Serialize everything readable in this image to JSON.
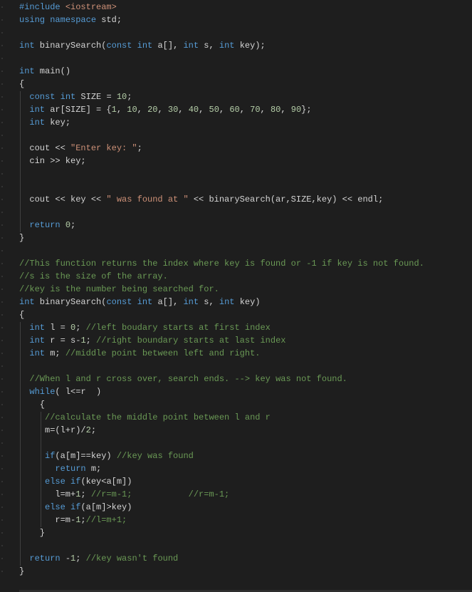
{
  "colors": {
    "background": "#1e1e1e",
    "keyword": "#569cd6",
    "string": "#ce9178",
    "number": "#b5cea8",
    "comment": "#6a9955",
    "text": "#d4d4d4"
  },
  "lines": [
    [
      [
        "p",
        "#include "
      ],
      [
        "s",
        "<iostream>"
      ]
    ],
    [
      [
        "k",
        "using"
      ],
      [
        "t",
        " "
      ],
      [
        "k",
        "namespace"
      ],
      [
        "t",
        " std;"
      ]
    ],
    [],
    [
      [
        "k",
        "int"
      ],
      [
        "t",
        " binarySearch("
      ],
      [
        "k",
        "const"
      ],
      [
        "t",
        " "
      ],
      [
        "k",
        "int"
      ],
      [
        "t",
        " a[], "
      ],
      [
        "k",
        "int"
      ],
      [
        "t",
        " s, "
      ],
      [
        "k",
        "int"
      ],
      [
        "t",
        " key);"
      ]
    ],
    [],
    [
      [
        "k",
        "int"
      ],
      [
        "t",
        " main()"
      ]
    ],
    [
      [
        "t",
        "{"
      ]
    ],
    [
      [
        "t",
        "  "
      ],
      [
        "k",
        "const"
      ],
      [
        "t",
        " "
      ],
      [
        "k",
        "int"
      ],
      [
        "t",
        " SIZE = "
      ],
      [
        "n",
        "10"
      ],
      [
        "t",
        ";"
      ]
    ],
    [
      [
        "t",
        "  "
      ],
      [
        "k",
        "int"
      ],
      [
        "t",
        " ar[SIZE] = {"
      ],
      [
        "n",
        "1"
      ],
      [
        "t",
        ", "
      ],
      [
        "n",
        "10"
      ],
      [
        "t",
        ", "
      ],
      [
        "n",
        "20"
      ],
      [
        "t",
        ", "
      ],
      [
        "n",
        "30"
      ],
      [
        "t",
        ", "
      ],
      [
        "n",
        "40"
      ],
      [
        "t",
        ", "
      ],
      [
        "n",
        "50"
      ],
      [
        "t",
        ", "
      ],
      [
        "n",
        "60"
      ],
      [
        "t",
        ", "
      ],
      [
        "n",
        "70"
      ],
      [
        "t",
        ", "
      ],
      [
        "n",
        "80"
      ],
      [
        "t",
        ", "
      ],
      [
        "n",
        "90"
      ],
      [
        "t",
        "};"
      ]
    ],
    [
      [
        "t",
        "  "
      ],
      [
        "k",
        "int"
      ],
      [
        "t",
        " key;"
      ]
    ],
    [],
    [
      [
        "t",
        "  cout << "
      ],
      [
        "s",
        "\"Enter key: \""
      ],
      [
        "t",
        ";"
      ]
    ],
    [
      [
        "t",
        "  cin >> key;"
      ]
    ],
    [],
    [],
    [
      [
        "t",
        "  cout << key << "
      ],
      [
        "s",
        "\" was found at \""
      ],
      [
        "t",
        " << binarySearch(ar,SIZE,key) << endl;"
      ]
    ],
    [],
    [
      [
        "t",
        "  "
      ],
      [
        "k",
        "return"
      ],
      [
        "t",
        " "
      ],
      [
        "n",
        "0"
      ],
      [
        "t",
        ";"
      ]
    ],
    [
      [
        "t",
        "}"
      ]
    ],
    [],
    [
      [
        "c",
        "//This function returns the index where key is found or -1 if key is not found."
      ]
    ],
    [
      [
        "c",
        "//s is the size of the array."
      ]
    ],
    [
      [
        "c",
        "//key is the number being searched for."
      ]
    ],
    [
      [
        "k",
        "int"
      ],
      [
        "t",
        " binarySearch("
      ],
      [
        "k",
        "const"
      ],
      [
        "t",
        " "
      ],
      [
        "k",
        "int"
      ],
      [
        "t",
        " a[], "
      ],
      [
        "k",
        "int"
      ],
      [
        "t",
        " s, "
      ],
      [
        "k",
        "int"
      ],
      [
        "t",
        " key)"
      ]
    ],
    [
      [
        "t",
        "{"
      ]
    ],
    [
      [
        "t",
        "  "
      ],
      [
        "k",
        "int"
      ],
      [
        "t",
        " l = "
      ],
      [
        "n",
        "0"
      ],
      [
        "t",
        "; "
      ],
      [
        "c",
        "//left boudary starts at first index"
      ]
    ],
    [
      [
        "t",
        "  "
      ],
      [
        "k",
        "int"
      ],
      [
        "t",
        " r = s-"
      ],
      [
        "n",
        "1"
      ],
      [
        "t",
        "; "
      ],
      [
        "c",
        "//right boundary starts at last index"
      ]
    ],
    [
      [
        "t",
        "  "
      ],
      [
        "k",
        "int"
      ],
      [
        "t",
        " m; "
      ],
      [
        "c",
        "//middle point between left and right."
      ]
    ],
    [],
    [
      [
        "t",
        "  "
      ],
      [
        "c",
        "//When l and r cross over, search ends. --> key was not found."
      ]
    ],
    [
      [
        "t",
        "  "
      ],
      [
        "k",
        "while"
      ],
      [
        "t",
        "( l<=r  )"
      ]
    ],
    [
      [
        "t",
        "    {"
      ]
    ],
    [
      [
        "t",
        "     "
      ],
      [
        "c",
        "//calculate the middle point between l and r"
      ]
    ],
    [
      [
        "t",
        "     m=(l+r)/"
      ],
      [
        "n",
        "2"
      ],
      [
        "t",
        ";"
      ]
    ],
    [],
    [
      [
        "t",
        "     "
      ],
      [
        "k",
        "if"
      ],
      [
        "t",
        "(a[m]==key) "
      ],
      [
        "c",
        "//key was found"
      ]
    ],
    [
      [
        "t",
        "       "
      ],
      [
        "k",
        "return"
      ],
      [
        "t",
        " m;"
      ]
    ],
    [
      [
        "t",
        "     "
      ],
      [
        "k",
        "else"
      ],
      [
        "t",
        " "
      ],
      [
        "k",
        "if"
      ],
      [
        "t",
        "(key<a[m])"
      ]
    ],
    [
      [
        "t",
        "       l=m+"
      ],
      [
        "n",
        "1"
      ],
      [
        "t",
        "; "
      ],
      [
        "c",
        "//r=m-1;           //r=m-1;"
      ]
    ],
    [
      [
        "t",
        "     "
      ],
      [
        "k",
        "else"
      ],
      [
        "t",
        " "
      ],
      [
        "k",
        "if"
      ],
      [
        "t",
        "(a[m]>key)"
      ]
    ],
    [
      [
        "t",
        "       r=m-"
      ],
      [
        "n",
        "1"
      ],
      [
        "t",
        ";"
      ],
      [
        "c",
        "//l=m+1;"
      ]
    ],
    [
      [
        "t",
        "    }"
      ]
    ],
    [],
    [
      [
        "t",
        "  "
      ],
      [
        "k",
        "return"
      ],
      [
        "t",
        " -"
      ],
      [
        "n",
        "1"
      ],
      [
        "t",
        "; "
      ],
      [
        "c",
        "//key wasn't found"
      ]
    ],
    [
      [
        "t",
        "}"
      ]
    ]
  ]
}
